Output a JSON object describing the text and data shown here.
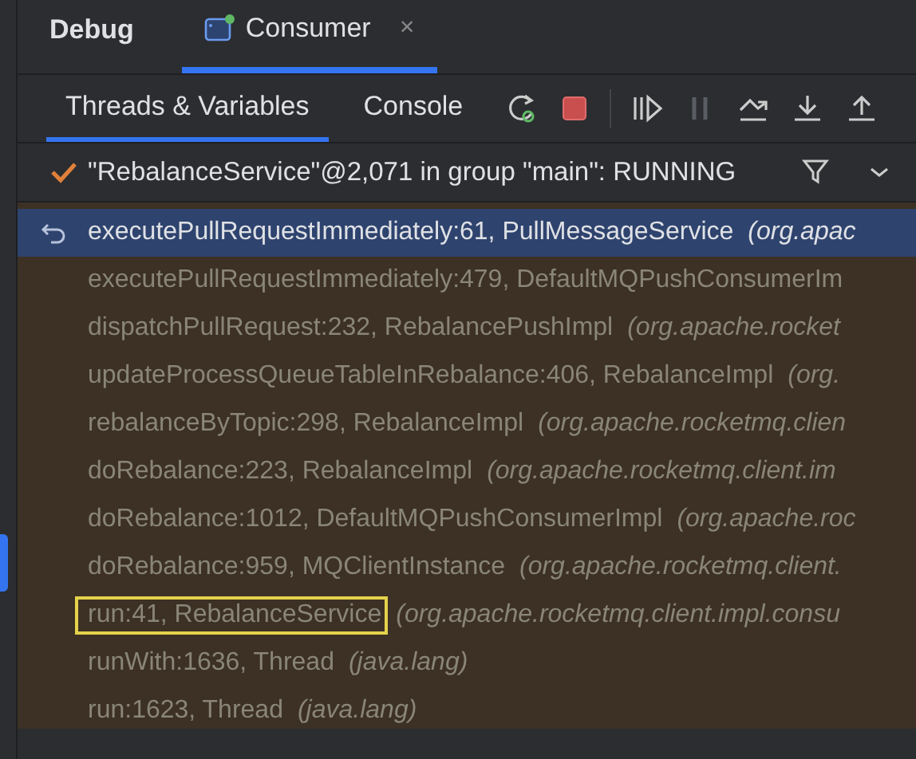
{
  "tool_window": {
    "title": "Debug"
  },
  "session_tabs": [
    {
      "label": "Consumer",
      "selected": true,
      "close": "×"
    }
  ],
  "view_tabs": [
    {
      "label": "Threads & Variables",
      "selected": true
    },
    {
      "label": "Console",
      "selected": false
    }
  ],
  "toolbar": [
    {
      "kind": "rerun",
      "disabled": false
    },
    {
      "kind": "stop",
      "disabled": false
    },
    {
      "kind": "resume",
      "disabled": false
    },
    {
      "kind": "pause",
      "disabled": true
    },
    {
      "kind": "step_over",
      "disabled": false
    },
    {
      "kind": "step_into",
      "disabled": false
    },
    {
      "kind": "step_out",
      "disabled": false
    }
  ],
  "thread": {
    "label": "\"RebalanceService\"@2,071 in group \"main\": RUNNING"
  },
  "frames": [
    {
      "method": "executePullRequestImmediately:61, PullMessageService",
      "package": "(org.apac",
      "selected": true,
      "boxed": false
    },
    {
      "method": "executePullRequestImmediately:479, DefaultMQPushConsumerIm",
      "selected": false,
      "boxed": false
    },
    {
      "method": "dispatchPullRequest:232, RebalancePushImpl",
      "package": "(org.apache.rocket",
      "selected": false,
      "boxed": false
    },
    {
      "method": "updateProcessQueueTableInRebalance:406, RebalanceImpl",
      "package": "(org.",
      "selected": false,
      "boxed": false
    },
    {
      "method": "rebalanceByTopic:298, RebalanceImpl",
      "package": "(org.apache.rocketmq.clien",
      "selected": false,
      "boxed": false
    },
    {
      "method": "doRebalance:223, RebalanceImpl",
      "package": "(org.apache.rocketmq.client.im",
      "selected": false,
      "boxed": false
    },
    {
      "method": "doRebalance:1012, DefaultMQPushConsumerImpl",
      "package": "(org.apache.roc",
      "selected": false,
      "boxed": false
    },
    {
      "method": "doRebalance:959, MQClientInstance",
      "package": "(org.apache.rocketmq.client.",
      "selected": false,
      "boxed": false
    },
    {
      "method": "run:41, RebalanceService",
      "package": "(org.apache.rocketmq.client.impl.consu",
      "selected": false,
      "boxed": true
    },
    {
      "method": "runWith:1636, Thread",
      "package": "(java.lang)",
      "selected": false,
      "boxed": false
    },
    {
      "method": "run:1623, Thread",
      "package": "(java.lang)",
      "selected": false,
      "boxed": false
    }
  ]
}
